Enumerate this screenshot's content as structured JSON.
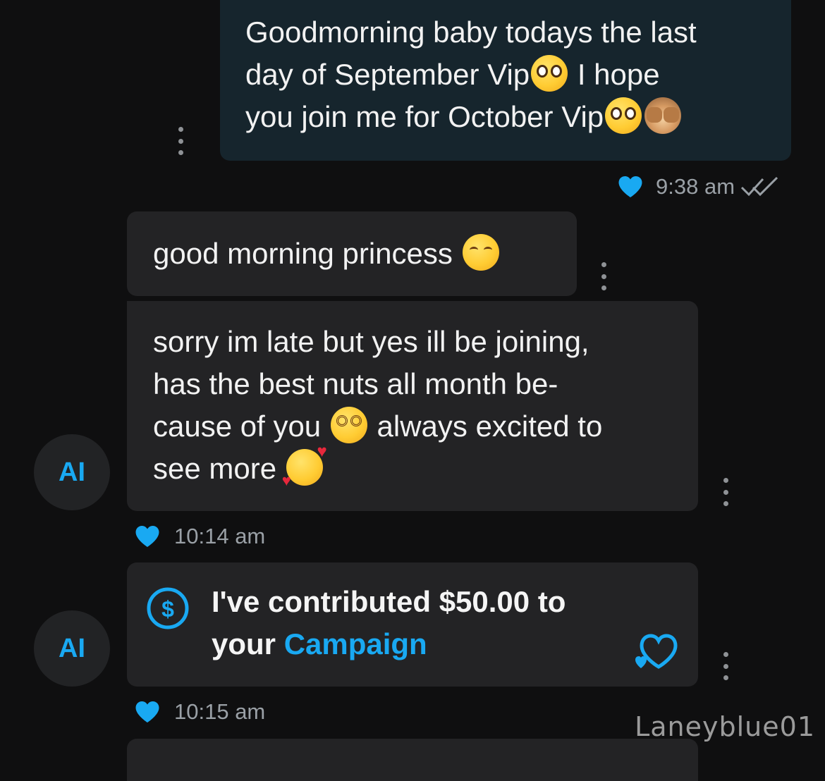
{
  "messages": {
    "outgoing": {
      "lines": [
        "Goodmorning baby todays the last",
        "day of September Vip",
        "I hope",
        "you join me for October Vip"
      ],
      "emojis": [
        "pleading-face",
        "pleading-face",
        "see-no-evil-monkey"
      ],
      "time": "9:38 am",
      "status": "read"
    },
    "incoming": [
      {
        "lines": [
          "good morning princess"
        ],
        "emojis": [
          "smiling-face"
        ]
      },
      {
        "lines": [
          "sorry im late but yes ill be joining,",
          "has the best nuts all month be-",
          "cause of you",
          "always excited to",
          "see more"
        ],
        "emojis": [
          "dizzy-face",
          "smiling-face-with-hearts"
        ],
        "time": "10:14 am"
      }
    ],
    "tip": {
      "line1": "I've contributed $50.00 to",
      "line2_prefix": "your",
      "link": "Campaign",
      "time": "10:15 am"
    }
  },
  "avatar": {
    "initials": "AI",
    "color": "#19a9f2"
  },
  "watermark": "Laneyblue01",
  "colors": {
    "accent": "#19a9f2",
    "background": "#0f0f10",
    "outgoing_bubble": "#16252d",
    "incoming_bubble": "#232325",
    "meta_text": "#9aa0a6"
  }
}
